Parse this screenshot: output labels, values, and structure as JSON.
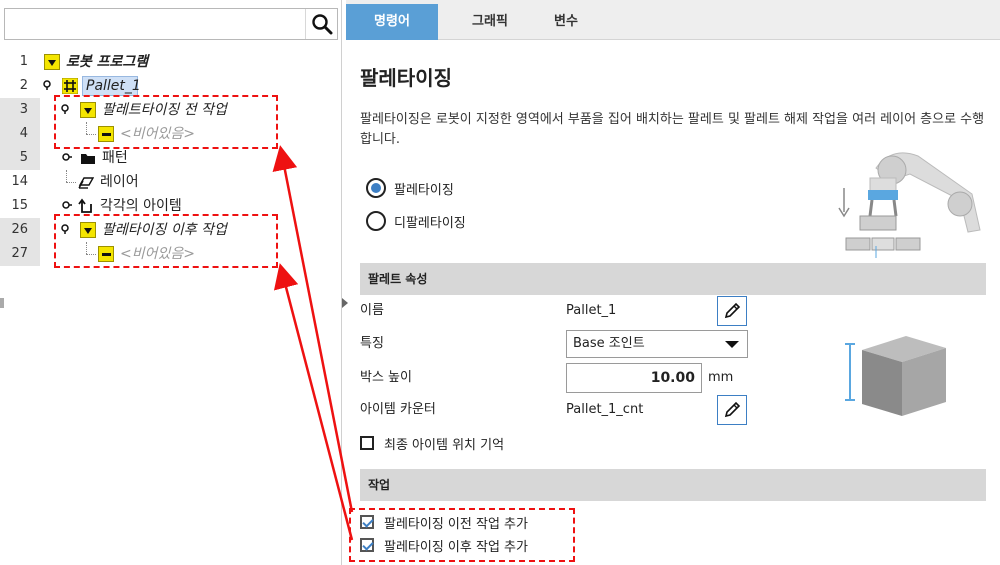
{
  "search": {
    "value": ""
  },
  "tree": {
    "rows": [
      {
        "line": "1",
        "label": "로봇 프로그램"
      },
      {
        "line": "2",
        "label": "Pallet_1"
      },
      {
        "line": "3",
        "label": "팔레트타이징 전 작업"
      },
      {
        "line": "4",
        "label": "<비어있음>"
      },
      {
        "line": "5",
        "label": "패턴"
      },
      {
        "line": "14",
        "label": "레이어"
      },
      {
        "line": "15",
        "label": "각각의 아이템"
      },
      {
        "line": "26",
        "label": "팔레타이징 이후 작업"
      },
      {
        "line": "27",
        "label": "<비어있음>"
      }
    ]
  },
  "tabs": [
    {
      "label": "명령어"
    },
    {
      "label": "그래픽"
    },
    {
      "label": "변수"
    }
  ],
  "main": {
    "heading": "팔레타이징",
    "description": "팔레타이징은 로봇이 지정한 영역에서 부품을 집어 배치하는 팔레트 및 팔레트 해제 작업을 여러 레이어 층으로 수행합니다.",
    "radio_palletizing": "팔레타이징",
    "radio_depalletizing": "디팔레타이징"
  },
  "pallet_props": {
    "section_title": "팔레트 속성",
    "name_label": "이름",
    "name_value": "Pallet_1",
    "feature_label": "특징",
    "feature_value": "Base 조인트",
    "box_height_label": "박스 높이",
    "box_height_value": "10.00",
    "box_height_unit": "mm",
    "item_counter_label": "아이템 카운터",
    "item_counter_value": "Pallet_1_cnt",
    "remember_last_item": "최종 아이템 위치 기억"
  },
  "actions": {
    "section_title": "작업",
    "add_before": "팔레타이징 이전 작업 추가",
    "add_after": "팔레타이징 이후 작업 추가"
  },
  "colors": {
    "accent": "#5a9fd6",
    "highlight_red": "#e11111",
    "tree_yellow": "#f4e500",
    "section_gray": "#d7d7d7"
  }
}
